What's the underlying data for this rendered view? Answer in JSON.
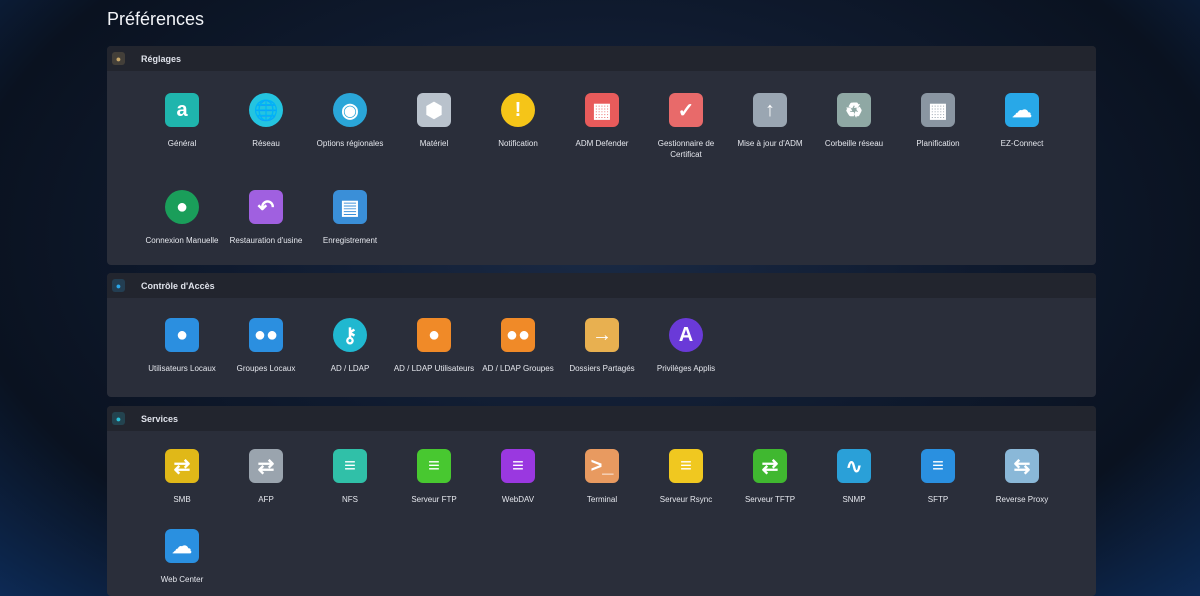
{
  "page_title": "Préférences",
  "sections": [
    {
      "title": "Réglages",
      "icon": "gear-icon",
      "icon_color": "#c8a86a",
      "items": [
        {
          "label": "Général",
          "icon": "asustor-a-icon",
          "color": "#1fb5ad"
        },
        {
          "label": "Réseau",
          "icon": "globe-network-icon",
          "color": "#24c4e0"
        },
        {
          "label": "Options régionales",
          "icon": "globe-pin-icon",
          "color": "#2aa6d8"
        },
        {
          "label": "Matériel",
          "icon": "hex-nut-icon",
          "color": "#b9c2cc"
        },
        {
          "label": "Notification",
          "icon": "alert-icon",
          "color": "#f5c518"
        },
        {
          "label": "ADM Defender",
          "icon": "firewall-icon",
          "color": "#e85b5b"
        },
        {
          "label": "Gestionnaire de Certificat",
          "icon": "certificate-icon",
          "color": "#e86a6a"
        },
        {
          "label": "Mise à jour d'ADM",
          "icon": "monitor-update-icon",
          "color": "#9aa6b2"
        },
        {
          "label": "Corbeille réseau",
          "icon": "recycle-bin-icon",
          "color": "#8fa8a4"
        },
        {
          "label": "Planification",
          "icon": "calendar-clock-icon",
          "color": "#8a96a2"
        },
        {
          "label": "EZ-Connect",
          "icon": "cloud-upload-icon",
          "color": "#28a8e8"
        },
        {
          "label": "Connexion Manuelle",
          "icon": "network-sphere-icon",
          "color": "#1a9e5a"
        },
        {
          "label": "Restauration d'usine",
          "icon": "undo-arrow-icon",
          "color": "#a060e0"
        },
        {
          "label": "Enregistrement",
          "icon": "clipboard-icon",
          "color": "#3a8fd8"
        }
      ]
    },
    {
      "title": "Contrôle d'Accès",
      "icon": "access-control-icon",
      "icon_color": "#2aa6e8",
      "items": [
        {
          "label": "Utilisateurs Locaux",
          "icon": "user-icon",
          "color": "#2b8fe0"
        },
        {
          "label": "Groupes Locaux",
          "icon": "users-icon",
          "color": "#2b8fe0"
        },
        {
          "label": "AD / LDAP",
          "icon": "key-icon",
          "color": "#20b8d0"
        },
        {
          "label": "AD / LDAP Utilisateurs",
          "icon": "ldap-user-icon",
          "color": "#f08a28"
        },
        {
          "label": "AD / LDAP Groupes",
          "icon": "ldap-group-icon",
          "color": "#f08a28"
        },
        {
          "label": "Dossiers Partagés",
          "icon": "shared-folder-icon",
          "color": "#e8b050"
        },
        {
          "label": "Privilèges Applis",
          "icon": "app-privilege-icon",
          "color": "#6a3ad8"
        }
      ]
    },
    {
      "title": "Services",
      "icon": "services-icon",
      "icon_color": "#2ac0d8",
      "items": [
        {
          "label": "SMB",
          "icon": "smb-folder-icon",
          "color": "#e0b818"
        },
        {
          "label": "AFP",
          "icon": "afp-folder-icon",
          "color": "#9aa4ae"
        },
        {
          "label": "NFS",
          "icon": "nfs-server-icon",
          "color": "#30c0a8"
        },
        {
          "label": "Serveur FTP",
          "icon": "ftp-server-icon",
          "color": "#48c830"
        },
        {
          "label": "WebDAV",
          "icon": "webdav-server-icon",
          "color": "#9a38e0"
        },
        {
          "label": "Terminal",
          "icon": "terminal-icon",
          "color": "#e89a60"
        },
        {
          "label": "Serveur Rsync",
          "icon": "rsync-server-icon",
          "color": "#f0c820"
        },
        {
          "label": "Serveur TFTP",
          "icon": "tftp-folder-icon",
          "color": "#40b830"
        },
        {
          "label": "SNMP",
          "icon": "snmp-monitor-icon",
          "color": "#2aa0d8"
        },
        {
          "label": "SFTP",
          "icon": "sftp-server-icon",
          "color": "#2a90e0"
        },
        {
          "label": "Reverse Proxy",
          "icon": "shield-proxy-icon",
          "color": "#8ab8d8"
        },
        {
          "label": "Web Center",
          "icon": "web-center-icon",
          "color": "#2a90e0"
        }
      ]
    }
  ]
}
